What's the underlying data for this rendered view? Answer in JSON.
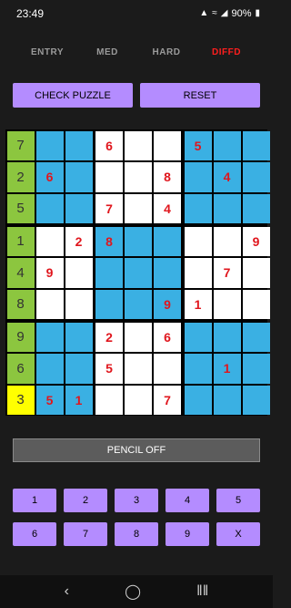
{
  "status": {
    "time": "23:49",
    "battery": "90%",
    "icons": [
      "notification-icon",
      "wifi-icon",
      "signal-icon",
      "battery-icon"
    ]
  },
  "tabs": [
    {
      "label": "ENTRY",
      "active": false
    },
    {
      "label": "MED",
      "active": false
    },
    {
      "label": "HARD",
      "active": false
    },
    {
      "label": "DIFFD",
      "active": true
    }
  ],
  "actions": {
    "check_label": "CHECK PUZZLE",
    "reset_label": "RESET"
  },
  "colors": {
    "accent_purple": "#b48cff",
    "cell_blue": "#3ab0e3",
    "cell_green": "#8cc63f",
    "cell_yellow": "#ffff00",
    "digit_red": "#e0161d"
  },
  "grid": {
    "rows": [
      [
        "7",
        "",
        "",
        "6",
        "",
        "",
        "5",
        "",
        ""
      ],
      [
        "2",
        "6",
        "",
        "",
        "",
        "8",
        "",
        "4",
        ""
      ],
      [
        "5",
        "",
        "",
        "7",
        "",
        "4",
        "",
        "",
        ""
      ],
      [
        "1",
        "",
        "2",
        "8",
        "",
        "",
        "",
        "",
        "9"
      ],
      [
        "4",
        "9",
        "",
        "",
        "",
        "",
        "",
        "7",
        ""
      ],
      [
        "8",
        "",
        "",
        "",
        "",
        "9",
        "1",
        "",
        ""
      ],
      [
        "9",
        "",
        "",
        "2",
        "",
        "6",
        "",
        "",
        ""
      ],
      [
        "6",
        "",
        "",
        "5",
        "",
        "",
        "",
        "1",
        ""
      ],
      [
        "3",
        "5",
        "1",
        "",
        "",
        "7",
        "",
        "",
        ""
      ]
    ],
    "highlighted_column": 0,
    "selected_cell": {
      "row": 8,
      "col": 0
    }
  },
  "pencil": {
    "label": "PENCIL OFF"
  },
  "keypad": [
    "1",
    "2",
    "3",
    "4",
    "5",
    "6",
    "7",
    "8",
    "9",
    "X"
  ],
  "navbar": {
    "back": "back-icon",
    "home": "home-icon",
    "recents": "recents-icon"
  }
}
